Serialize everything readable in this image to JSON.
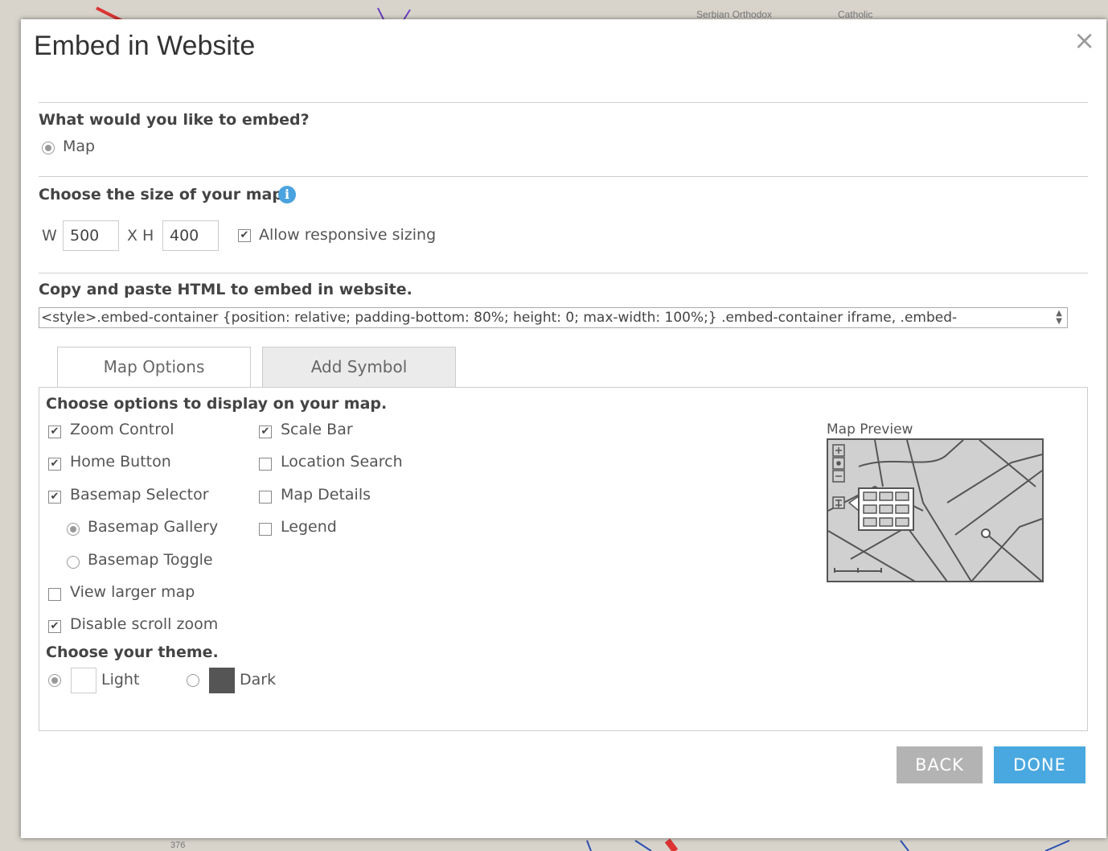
{
  "background": {
    "map_labels": [
      "Serbian Orthodox",
      "Catholic",
      "376"
    ]
  },
  "dialog": {
    "title": "Embed in Website",
    "close_symbol": "×",
    "embed_question": "What would you like to embed?",
    "embed_option": "Map",
    "size_label": "Choose the size of your map.",
    "info_icon": "i",
    "width_prefix": "W",
    "width_value": "500",
    "height_prefix": "X  H",
    "height_value": "400",
    "responsive_label": "Allow responsive sizing",
    "responsive_checked": true,
    "copy_label": "Copy and paste HTML to embed in website.",
    "embed_code": "<style>.embed-container {position: relative; padding-bottom: 80%; height: 0; max-width: 100%;} .embed-container iframe, .embed-",
    "tabs": [
      {
        "label": "Map Options",
        "active": true
      },
      {
        "label": "Add Symbol",
        "active": false
      }
    ],
    "options_heading": "Choose options to display on your map.",
    "options_col1": [
      {
        "label": "Zoom Control",
        "checked": true
      },
      {
        "label": "Home Button",
        "checked": true
      },
      {
        "label": "Basemap Selector",
        "checked": true
      }
    ],
    "basemap_radios": [
      {
        "label": "Basemap Gallery",
        "selected": true
      },
      {
        "label": "Basemap Toggle",
        "selected": false
      }
    ],
    "options_col1_extra": [
      {
        "label": "View larger map",
        "checked": false
      },
      {
        "label": "Disable scroll zoom",
        "checked": true
      }
    ],
    "options_col2": [
      {
        "label": "Scale Bar",
        "checked": true
      },
      {
        "label": "Location Search",
        "checked": false
      },
      {
        "label": "Map Details",
        "checked": false
      },
      {
        "label": "Legend",
        "checked": false
      }
    ],
    "theme_heading": "Choose your theme.",
    "themes": [
      {
        "label": "Light",
        "selected": true,
        "color": "#ffffff"
      },
      {
        "label": "Dark",
        "selected": false,
        "color": "#555555"
      }
    ],
    "preview_label": "Map Preview",
    "back_label": "BACK",
    "done_label": "DONE",
    "colors": {
      "back": "#b3b3b3",
      "done": "#4aa8e0",
      "info": "#4aa3df"
    }
  }
}
